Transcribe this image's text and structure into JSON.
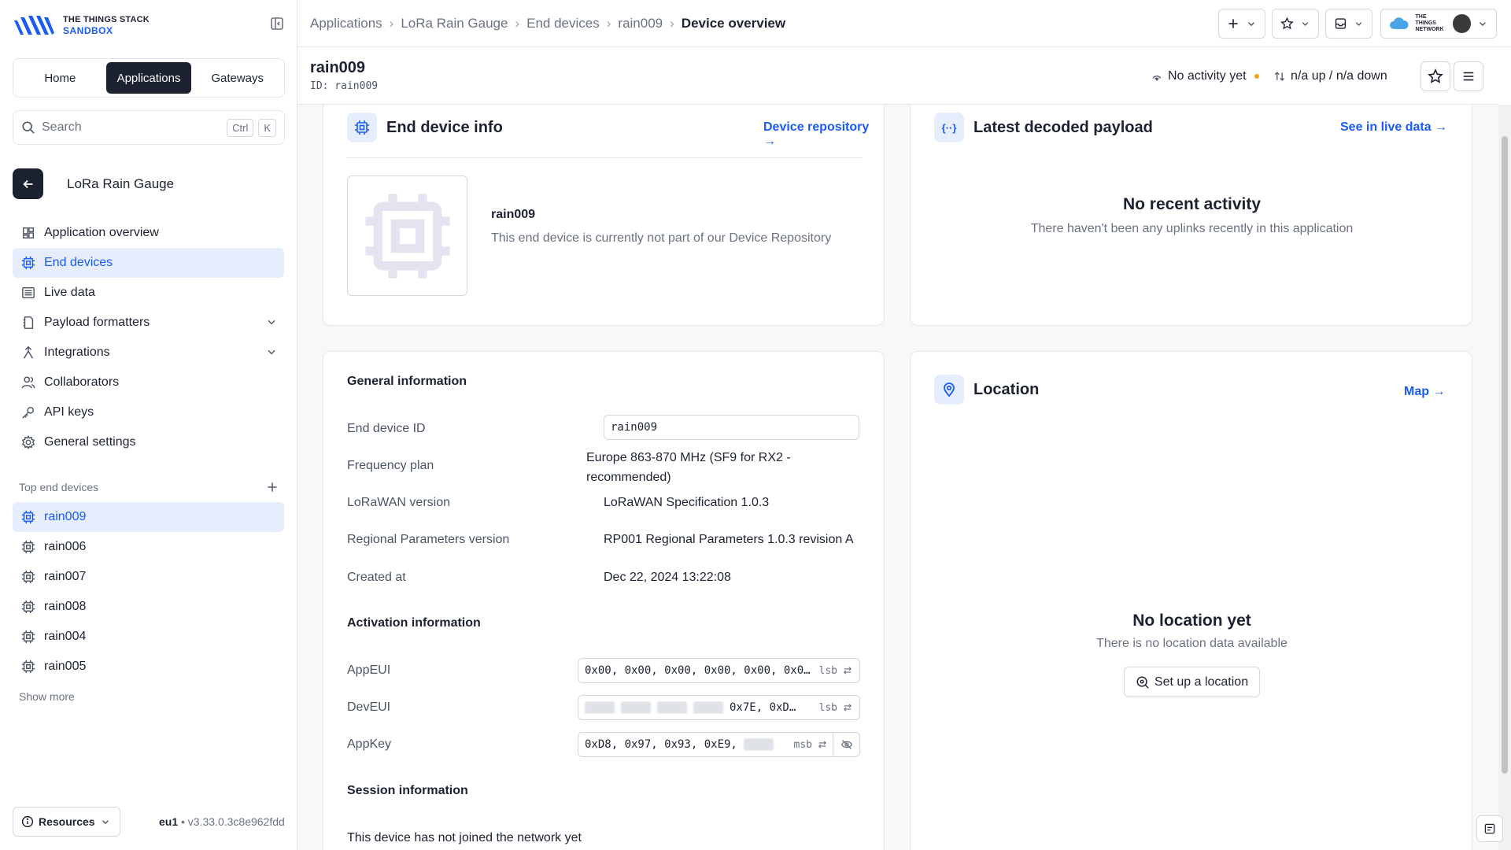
{
  "brand": {
    "line1": "THE THINGS STACK",
    "line2": "SANDBOX"
  },
  "switcher": {
    "home": "Home",
    "applications": "Applications",
    "gateways": "Gateways"
  },
  "search": {
    "placeholder": "Search",
    "key1": "Ctrl",
    "key2": "K"
  },
  "app": {
    "name": "LoRa Rain Gauge"
  },
  "nav": [
    {
      "label": "Application overview",
      "icon": "grid-icon"
    },
    {
      "label": "End devices",
      "icon": "chip-icon"
    },
    {
      "label": "Live data",
      "icon": "list-icon"
    },
    {
      "label": "Payload formatters",
      "icon": "code-icon"
    },
    {
      "label": "Integrations",
      "icon": "integration-icon"
    },
    {
      "label": "Collaborators",
      "icon": "users-icon"
    },
    {
      "label": "API keys",
      "icon": "key-icon"
    },
    {
      "label": "General settings",
      "icon": "gear-icon"
    }
  ],
  "top_devices": {
    "heading": "Top end devices",
    "items": [
      "rain009",
      "rain006",
      "rain007",
      "rain008",
      "rain004",
      "rain005"
    ],
    "show_more": "Show more"
  },
  "footer": {
    "resources": "Resources",
    "region": "eu1",
    "version": "• v3.33.0.3c8e962fdd"
  },
  "breadcrumb": [
    "Applications",
    "LoRa Rain Gauge",
    "End devices",
    "rain009",
    "Device overview"
  ],
  "network_label": "THE THINGS NETWORK",
  "header": {
    "title": "rain009",
    "id_text": "ID: rain009",
    "activity": "No activity yet",
    "traffic": "n/a up / n/a down"
  },
  "device_info": {
    "title": "End device info",
    "repo_link": "Device repository →",
    "name": "rain009",
    "description": "This end device is currently not part of our Device Repository"
  },
  "payload": {
    "title": "Latest decoded payload",
    "link": "See in live data →",
    "empty_title": "No recent activity",
    "empty_text": "There haven't been any uplinks recently in this application"
  },
  "general": {
    "heading": "General information",
    "rows": [
      {
        "label": "End device ID",
        "value": "rain009"
      },
      {
        "label": "Frequency plan",
        "value": "Europe 863-870 MHz (SF9 for RX2 -",
        "value2": "recommended)"
      },
      {
        "label": "LoRaWAN version",
        "value": "LoRaWAN Specification 1.0.3"
      },
      {
        "label": "Regional Parameters version",
        "value": "RP001 Regional Parameters 1.0.3 revision A"
      },
      {
        "label": "Created at",
        "value": "Dec 22, 2024 13:22:08"
      }
    ]
  },
  "activation": {
    "heading": "Activation information",
    "appeui": {
      "label": "AppEUI",
      "value": "0x00, 0x00, 0x00, 0x00, 0x00, 0x0…",
      "enc": "lsb"
    },
    "deveui": {
      "label": "DevEUI",
      "value": "0x7E, 0xD…",
      "enc": "lsb"
    },
    "appkey": {
      "label": "AppKey",
      "value": "0xD8, 0x97, 0x93, 0xE9,",
      "enc": "msb"
    }
  },
  "session": {
    "heading": "Session information",
    "text": "This device has not joined the network yet"
  },
  "location": {
    "title": "Location",
    "link": "Map →",
    "empty_title": "No location yet",
    "empty_text": "There is no location data available",
    "button": "Set up a location"
  },
  "colors": {
    "accent": "#1a5cf2",
    "dark": "#1c2230",
    "active_bg": "#e6eefd",
    "warning": "#f2a516"
  }
}
